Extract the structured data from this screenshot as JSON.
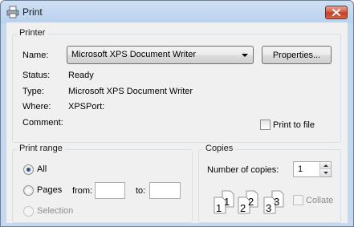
{
  "window": {
    "title": "Print",
    "icon": "printer-icon",
    "close_icon": "close-icon"
  },
  "printer": {
    "group_title": "Printer",
    "name_label": "Name:",
    "name_value": "Microsoft XPS Document Writer",
    "properties_label": "Properties...",
    "status_label": "Status:",
    "status_value": "Ready",
    "type_label": "Type:",
    "type_value": "Microsoft XPS Document Writer",
    "where_label": "Where:",
    "where_value": "XPSPort:",
    "comment_label": "Comment:",
    "comment_value": "",
    "print_to_file_label": "Print to file",
    "print_to_file_checked": false
  },
  "print_range": {
    "group_title": "Print range",
    "all_label": "All",
    "pages_label": "Pages",
    "from_label": "from:",
    "to_label": "to:",
    "from_value": "",
    "to_value": "",
    "selection_label": "Selection",
    "selected": "All"
  },
  "copies": {
    "group_title": "Copies",
    "number_label": "Number of copies:",
    "number_value": "1",
    "collate_label": "Collate",
    "collate_checked": false,
    "collate_pages": [
      "1",
      "1",
      "2",
      "2",
      "3",
      "3"
    ]
  }
}
